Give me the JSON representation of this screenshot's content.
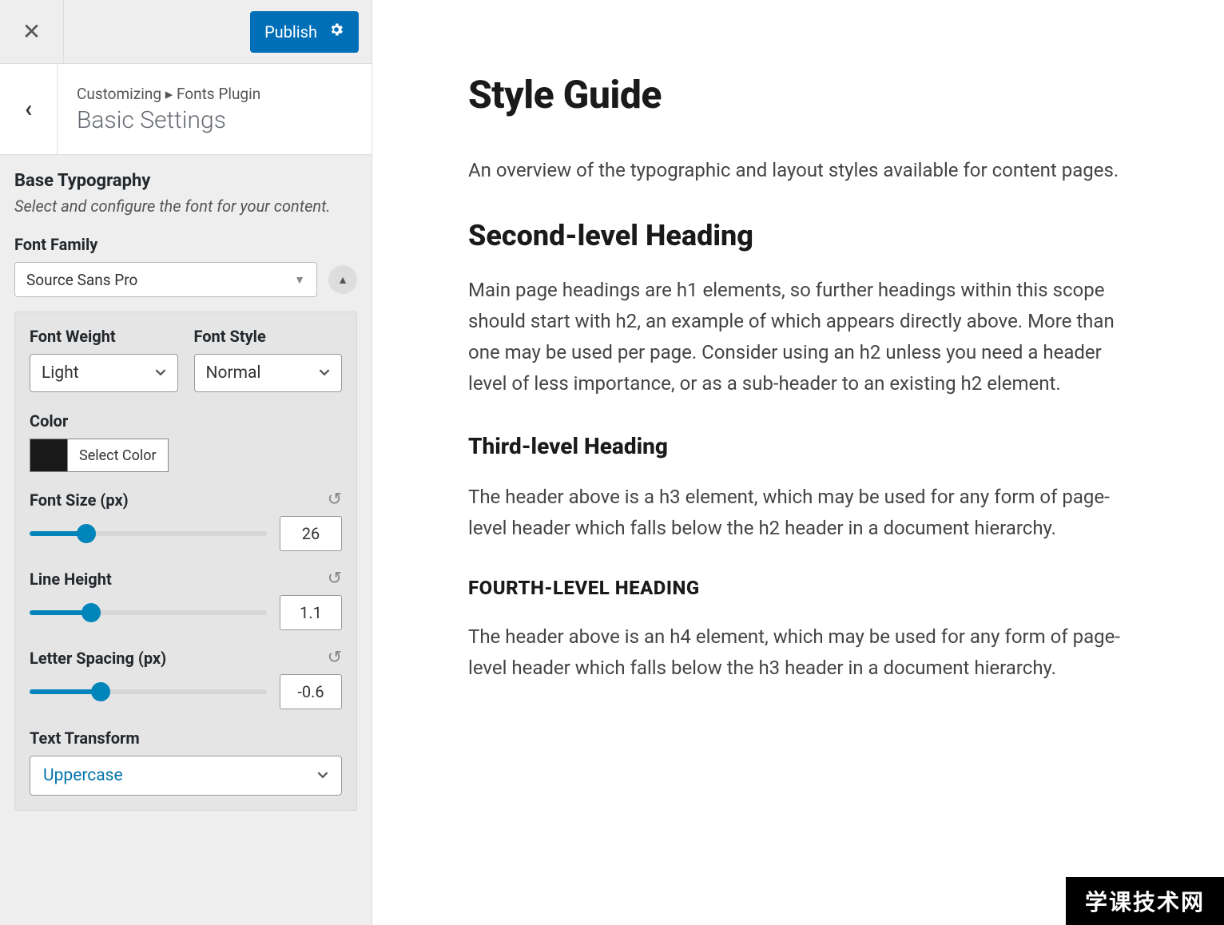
{
  "topbar": {
    "publish_label": "Publish"
  },
  "header": {
    "breadcrumb": "Customizing ▸ Fonts Plugin",
    "section": "Basic Settings"
  },
  "typography": {
    "group_title": "Base Typography",
    "group_desc": "Select and configure the font for your content.",
    "font_family_label": "Font Family",
    "font_family_value": "Source Sans Pro",
    "font_weight_label": "Font Weight",
    "font_weight_value": "Light",
    "font_style_label": "Font Style",
    "font_style_value": "Normal",
    "color_label": "Color",
    "color_button": "Select Color",
    "color_value": "#19191a",
    "font_size_label": "Font Size (px)",
    "font_size_value": "26",
    "line_height_label": "Line Height",
    "line_height_value": "1.1",
    "letter_spacing_label": "Letter Spacing (px)",
    "letter_spacing_value": "-0.6",
    "text_transform_label": "Text Transform",
    "text_transform_value": "Uppercase"
  },
  "preview": {
    "h1": "Style Guide",
    "p1": "An overview of the typographic and layout styles available for content pages.",
    "h2": "Second-level Heading",
    "p2": "Main page headings are h1 elements, so further headings within this scope should start with h2, an example of which appears directly above. More than one may be used per page. Consider using an h2 unless you need a header level of less importance, or as a sub-header to an existing h2 element.",
    "h3": "Third-level Heading",
    "p3": "The header above is a h3 element, which may be used for any form of page-level header which falls below the h2 header in a document hierarchy.",
    "h4": "FOURTH-LEVEL HEADING",
    "p4": "The header above is an h4 element, which may be used for any form of page-level header which falls below the h3 header in a document hierarchy."
  },
  "watermark": "学课技术网"
}
